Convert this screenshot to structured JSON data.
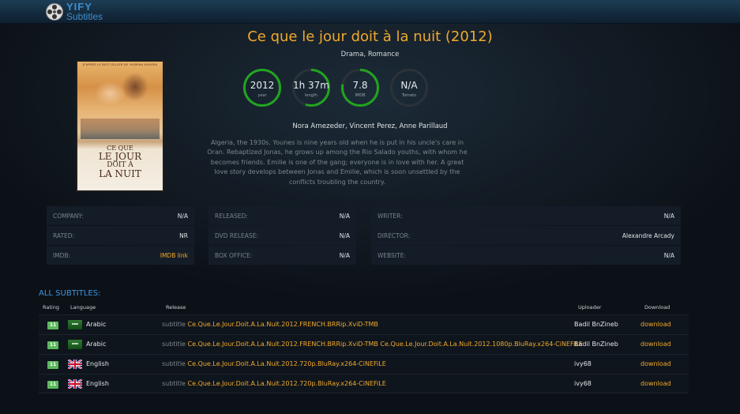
{
  "header": {
    "logo_top": "YIFY",
    "logo_bottom": "Subtitles"
  },
  "movie": {
    "title": "Ce que le jour doit à la nuit (2012)",
    "genres": "Drama, Romance",
    "poster": {
      "top_line": "D'APRÈS LE BEST-SELLER DE YASMINA KHADRA",
      "title_lines": [
        "CE QUE",
        "LE JOUR",
        "DOIT À",
        "LA NUIT"
      ]
    },
    "stats": [
      {
        "value": "2012",
        "label": "year",
        "fill": 1.0
      },
      {
        "value": "1h 37m",
        "label": "length",
        "fill": 0.55
      },
      {
        "value": "7.8",
        "label": "IMDB",
        "fill": 0.78
      },
      {
        "value": "N/A",
        "label": "Tomato",
        "fill": 0.0
      }
    ],
    "stat_colors": {
      "fill": "#22a41f",
      "track": "#2b3239"
    },
    "cast": "Nora Arnezeder, Vincent Perez, Anne Parillaud",
    "plot": "Algeria, the 1930s. Younes is nine years old when he is put in his uncle's care in Oran. Rebaptized Jonas, he grows up among the Rio Salado youths, with whom he becomes friends. Emilie is one of the gang; everyone is in love with her. A great love story develops between Jonas and Emilie, which is soon unsettled by the conflicts troubling the country."
  },
  "info": {
    "col1": [
      {
        "label": "COMPANY:",
        "value": "N/A"
      },
      {
        "label": "RATED:",
        "value": "NR"
      },
      {
        "label": "IMDB:",
        "value": "IMDB link"
      }
    ],
    "col2": [
      {
        "label": "RELEASED:",
        "value": "N/A"
      },
      {
        "label": "DVD RELEASE:",
        "value": "N/A"
      },
      {
        "label": "BOX OFFICE:",
        "value": "N/A"
      }
    ],
    "col3": [
      {
        "label": "WRITER:",
        "value": "N/A"
      },
      {
        "label": "DIRECTOR:",
        "value": "Alexandre Arcady"
      },
      {
        "label": "WEBSITE:",
        "value": "N/A"
      }
    ]
  },
  "subtitles": {
    "heading": "ALL SUBTITLES:",
    "columns": {
      "rating": "Rating",
      "language": "Language",
      "release": "Release",
      "uploader": "Uploader",
      "download": "Download"
    },
    "rows": [
      {
        "rating": "11",
        "flag": "saudi-arabia-flag",
        "language": "Arabic",
        "prefix": "subtitle",
        "release": "Ce.Que.Le.Jour.Doit.A.La.Nuit.2012.FRENCH.BRRip.XviD-TMB",
        "uploader": "Badil BnZineb",
        "download": "download"
      },
      {
        "rating": "11",
        "flag": "saudi-arabia-flag",
        "language": "Arabic",
        "prefix": "subtitle",
        "release": "Ce.Que.Le.Jour.Doit.A.La.Nuit.2012.FRENCH.BRRip.XviD-TMB Ce.Que.Le.Jour.Doit.A.La.Nuit.2012.1080p.BluRay.x264-CiNEFiLE",
        "uploader": "Badil BnZineb",
        "download": "download"
      },
      {
        "rating": "11",
        "flag": "uk-flag",
        "language": "English",
        "prefix": "subtitle",
        "release": "Ce.Que.Le.Jour.Doit.A.La.Nuit.2012.720p.BluRay.x264-CiNEFiLE",
        "uploader": "ivy68",
        "download": "download"
      },
      {
        "rating": "11",
        "flag": "uk-flag",
        "language": "English",
        "prefix": "subtitle",
        "release": "Ce.Que.Le.Jour.Doit.A.La.Nuit.2012.720p.BluRay.x264-CiNEFiLE",
        "uploader": "ivy68",
        "download": "download"
      }
    ]
  }
}
